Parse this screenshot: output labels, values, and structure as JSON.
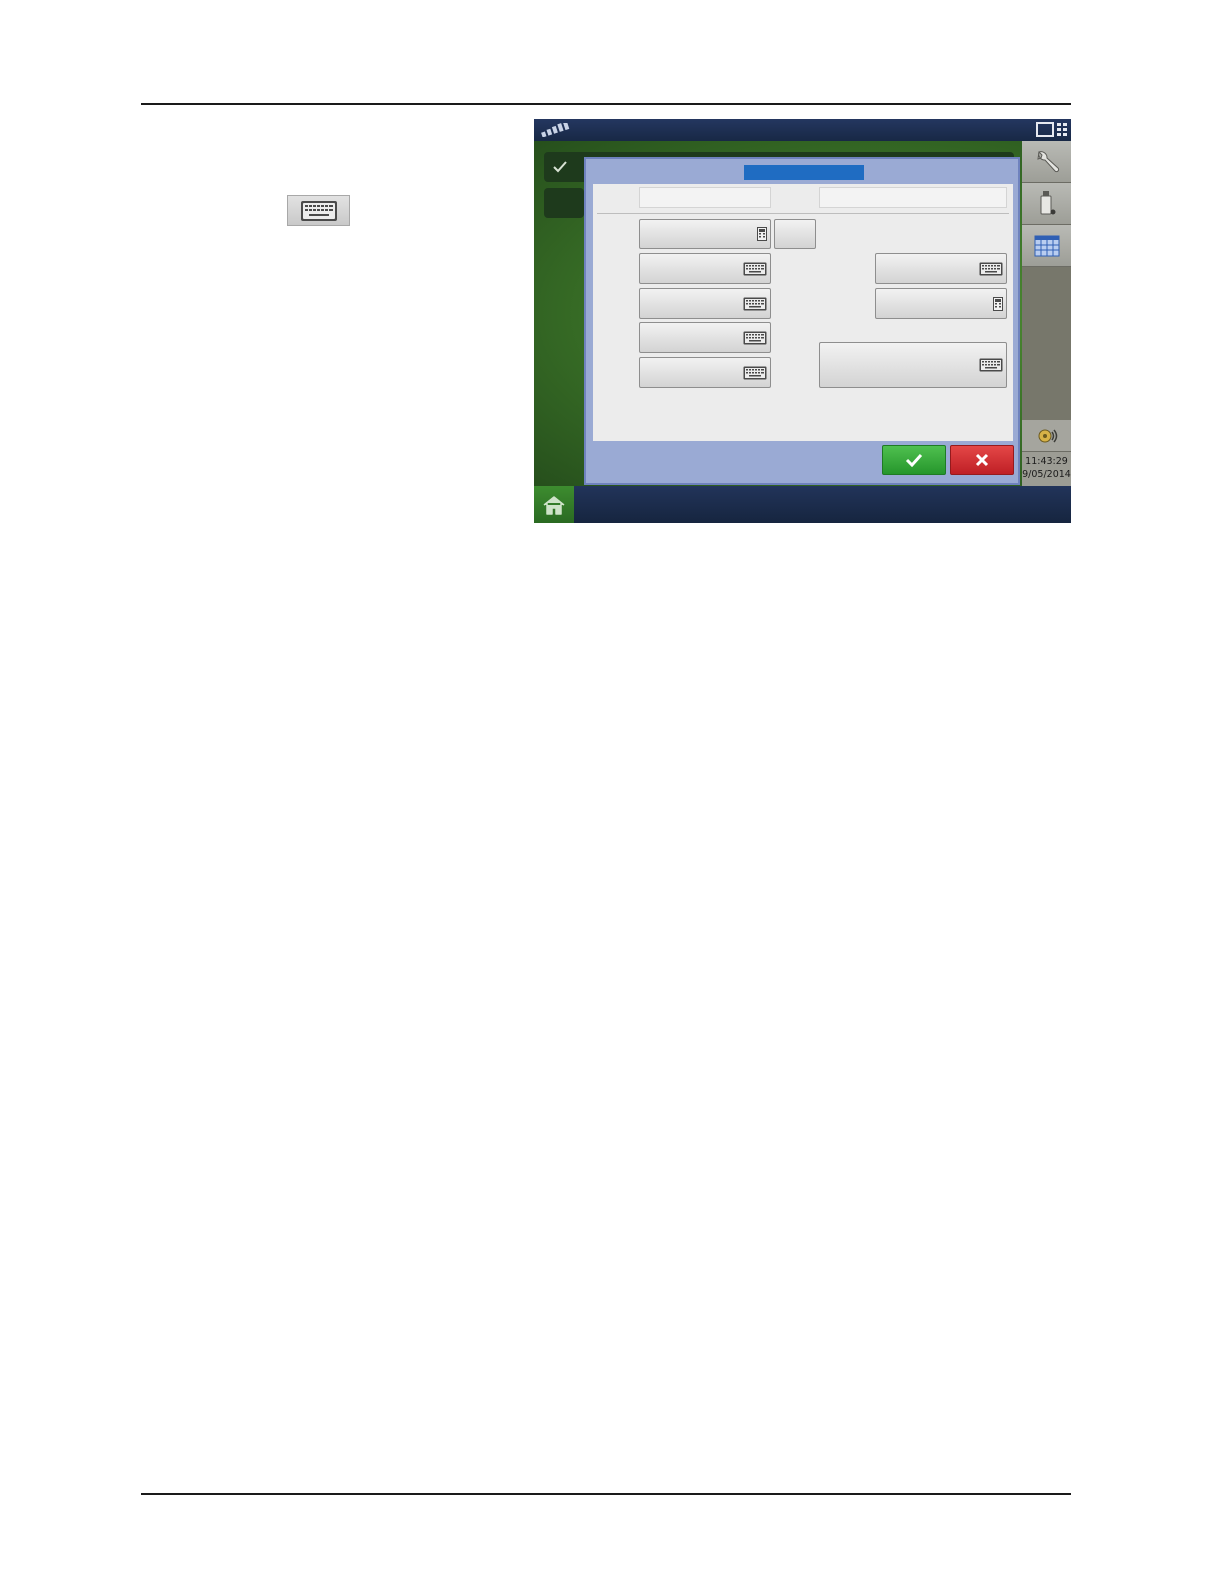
{
  "screen": {
    "clock": {
      "time": "11:43:29",
      "date": "9/05/2014"
    },
    "sidebar": {
      "icons": [
        "wrench-icon",
        "usb-drive-icon",
        "grid-table-icon",
        "settings-lights-icon"
      ]
    },
    "bottom_bar": {
      "home_icon": "home-icon"
    },
    "dialog": {
      "ok_icon": "check-icon",
      "cancel_icon": "close-x-icon",
      "colors": {
        "ok": "#2ea33a",
        "cancel": "#d3282e",
        "title_bar": "#1f6cc2",
        "frame": "#9aaad4"
      }
    }
  },
  "legend": {
    "keyboard_icon": "keyboard-icon"
  }
}
